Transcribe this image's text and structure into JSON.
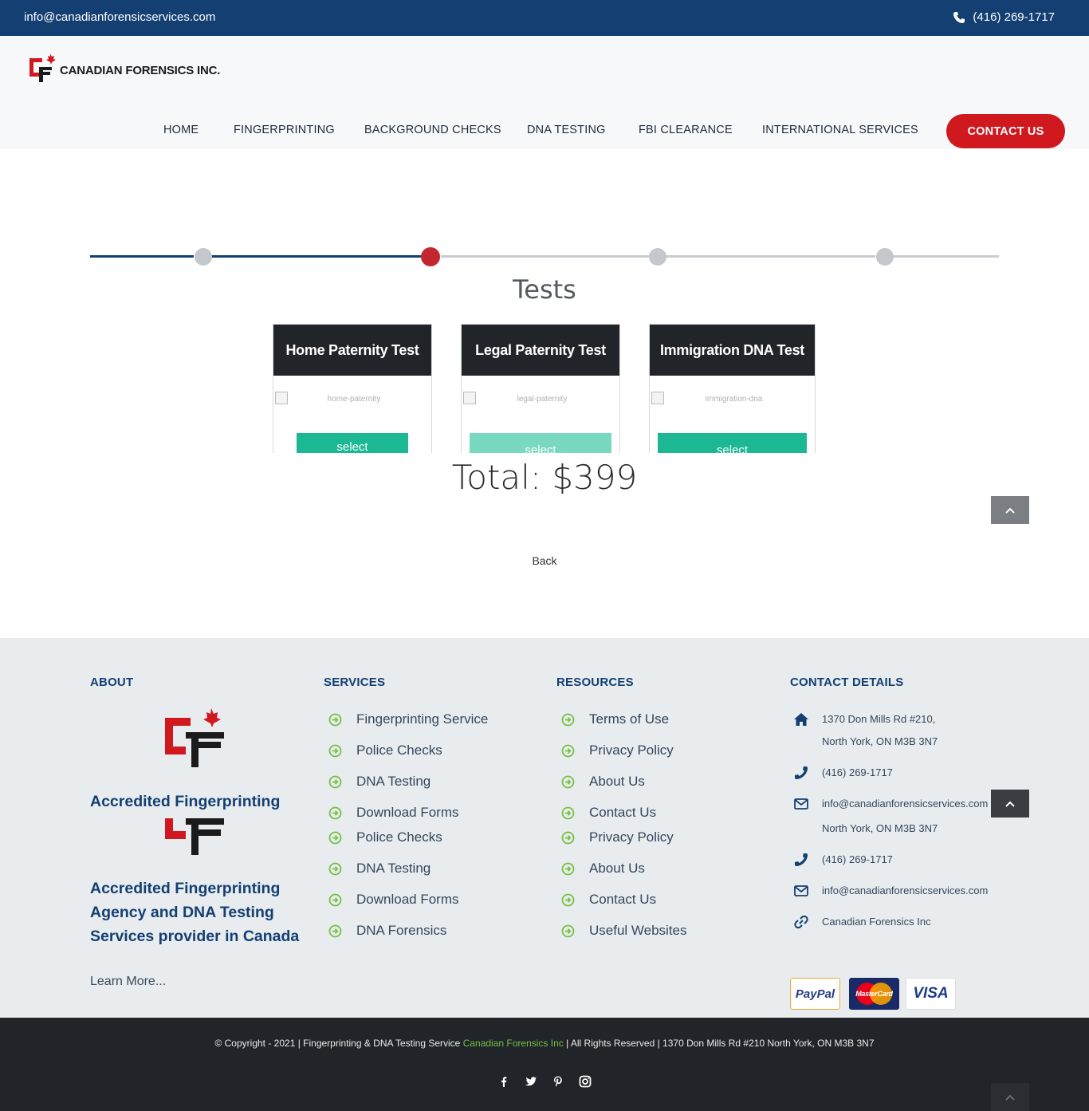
{
  "topbar": {
    "email": "info@canadianforensicservices.com",
    "phone": "(416) 269-1717"
  },
  "header": {
    "brand": "CANADIAN FORENSICS INC.",
    "nav": [
      "HOME",
      "FINGERPRINTING",
      "BACKGROUND CHECKS",
      "DNA TESTING",
      "FBI CLEARANCE",
      "INTERNATIONAL SERVICES"
    ],
    "contact_label": "CONTACT US"
  },
  "progress": {
    "total_steps": 5,
    "current_step": 3
  },
  "tests": {
    "title": "Tests",
    "cards": [
      {
        "title": "Home Paternity Test",
        "image_alt": "home-paternity",
        "button": "select"
      },
      {
        "title": "Legal Paternity Test",
        "image_alt": "legal-paternity",
        "button": "select"
      },
      {
        "title": "Immigration DNA Test",
        "image_alt": "immigration-dna",
        "button": "select"
      }
    ],
    "total": "Total: $399",
    "back": "Back"
  },
  "footer": {
    "about": {
      "heading": "ABOUT",
      "text1": "Accredited Fingerprinting",
      "text2": "Accredited Fingerprinting Agency and DNA Testing Services provider in Canada",
      "learn_more": "Learn More..."
    },
    "services": {
      "heading": "SERVICES",
      "items": [
        "Fingerprinting Service",
        "Police Checks",
        "DNA Testing",
        "Download Forms",
        "Police Checks",
        "DNA Testing",
        "Download Forms",
        "DNA Forensics"
      ]
    },
    "resources": {
      "heading": "RESOURCES",
      "items": [
        "Terms of Use",
        "Privacy Policy",
        "About Us",
        "Contact Us",
        "Privacy Policy",
        "About Us",
        "Contact Us",
        "Useful Websites"
      ]
    },
    "contact": {
      "heading": "CONTACT DETAILS",
      "address_line1": "1370 Don Mills Rd #210,",
      "address_line2": "North York, ON M3B 3N7",
      "phone": "(416) 269-1717",
      "email": "info@canadianforensicservices.com",
      "address_line2_repeat": "North York, ON M3B 3N7",
      "phone_repeat": "(416) 269-1717",
      "email_repeat": "info@canadianforensicservices.com",
      "website": "Canadian Forensics Inc"
    },
    "payments": [
      "PayPal",
      "MasterCard",
      "VISA"
    ]
  },
  "bottom": {
    "copyright_before": "© Copyright - 2021 | Fingerprinting & DNA Testing Service ",
    "copyright_link": "Canadian Forensics Inc",
    "copyright_after": " | All Rights Reserved | 1370 Don Mills Rd #210 North York, ON M3B 3N7",
    "social": [
      "facebook-icon",
      "twitter-icon",
      "pinterest-icon",
      "instagram-icon"
    ]
  },
  "colors": {
    "navy": "#143f72",
    "red": "#d0181f",
    "teal": "#1bb893",
    "green": "#76c043",
    "dark": "#212429"
  }
}
